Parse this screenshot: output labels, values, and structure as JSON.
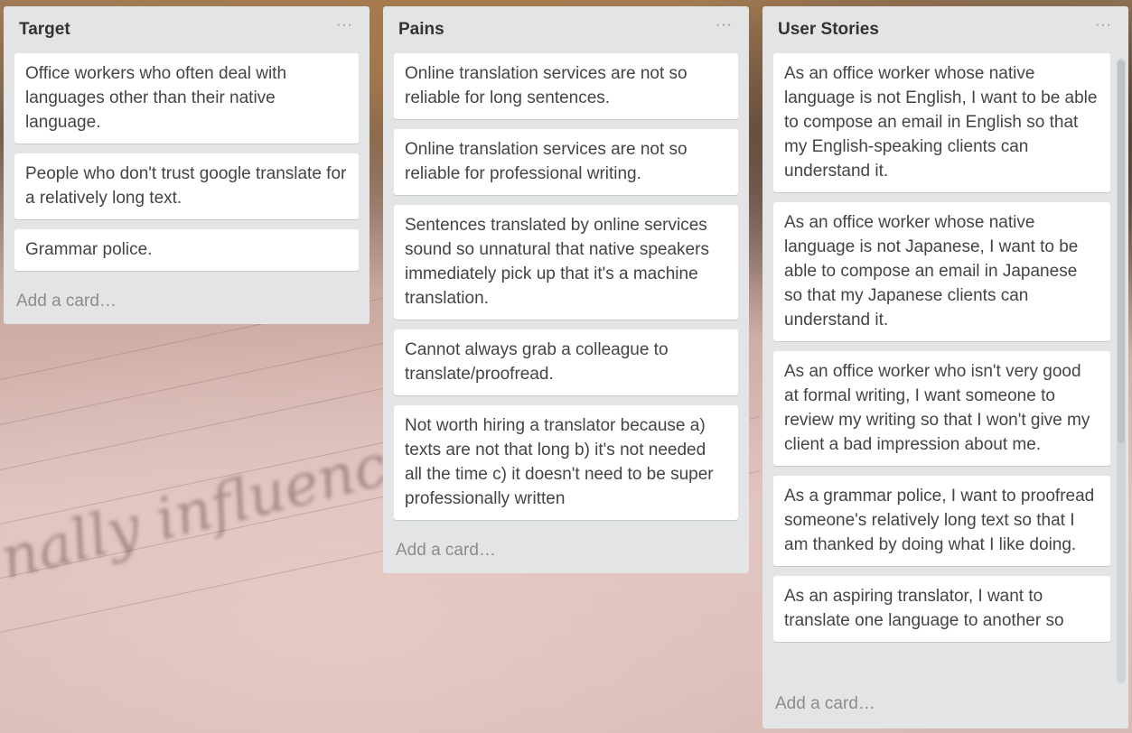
{
  "lists": [
    {
      "title": "Target",
      "menu": "···",
      "cards": [
        "Office workers who often deal with languages other than their native language.",
        "People who don't trust google translate for a relatively long text.",
        "Grammar police."
      ],
      "add_card": "Add a card…"
    },
    {
      "title": "Pains",
      "menu": "···",
      "cards": [
        "Online translation services are not so reliable for long sentences.",
        "Online translation services are not so reliable for professional writing.",
        "Sentences translated by online services sound so unnatural that native speakers immediately pick up that it's a machine translation.",
        "Cannot always grab a colleague to translate/proofread.",
        "Not worth hiring a translator because a) texts are not that long b) it's not needed all the time c) it doesn't need to be super professionally written"
      ],
      "add_card": "Add a card…"
    },
    {
      "title": "User Stories",
      "menu": "···",
      "cards": [
        "As an office worker whose native language is not English, I want to be able to compose an email in English so that my English-speaking clients can understand it.",
        "As an office worker whose native language is not Japanese, I want to be able to compose an email in Japanese so that my Japanese clients can understand it.",
        "As an office worker who isn't very good at formal writing, I want someone to review my writing so that I won't give my client a bad impression about me.",
        "As a grammar police, I want to proofread someone's relatively long text so that I am thanked by doing what I like doing.",
        "As an aspiring translator, I want to translate one language to another so"
      ],
      "add_card": "Add a card…"
    }
  ]
}
